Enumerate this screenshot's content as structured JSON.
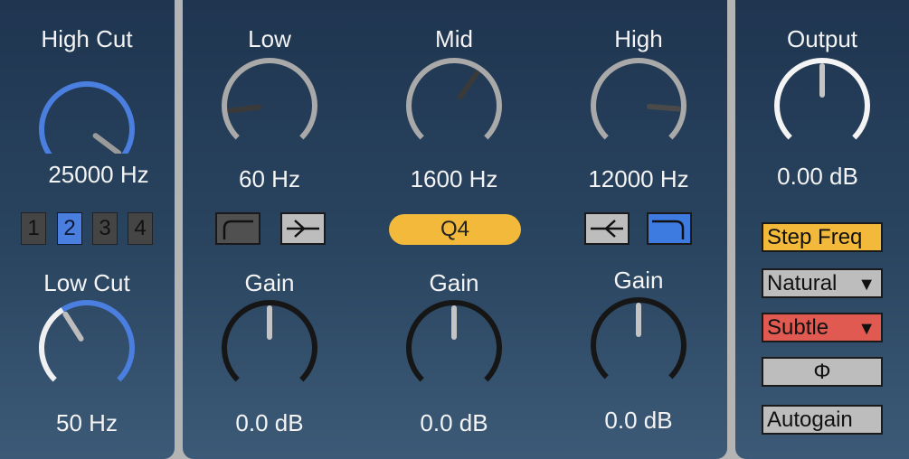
{
  "highcut": {
    "title": "High Cut",
    "value": "25000 Hz",
    "knob_level": 0.97
  },
  "band_selector": [
    {
      "label": "1",
      "active": false
    },
    {
      "label": "2",
      "active": true
    },
    {
      "label": "3",
      "active": false
    },
    {
      "label": "4",
      "active": false
    }
  ],
  "lowcut": {
    "title": "Low Cut",
    "value": "50 Hz",
    "knob_level": 0.38
  },
  "bands": [
    {
      "title": "Low",
      "freq": "60 Hz",
      "gain_label": "Gain",
      "gain": "0.0 dB",
      "freq_level": 0.14,
      "gain_level": 0.5
    },
    {
      "title": "Mid",
      "freq": "1600 Hz",
      "gain_label": "Gain",
      "gain": "0.0 dB",
      "freq_level": 0.63,
      "gain_level": 0.5
    },
    {
      "title": "High",
      "freq": "12000 Hz",
      "gain_label": "Gain",
      "gain": "0.0 dB",
      "freq_level": 0.85,
      "gain_level": 0.5
    }
  ],
  "slope": {
    "label": "Q4"
  },
  "filter_buttons": {
    "low_cut_shelf": {
      "icon": "lowcut-shape-icon",
      "active": false
    },
    "low_shelf": {
      "icon": "low-shelf-icon",
      "active": true
    },
    "high_shelf": {
      "icon": "high-shelf-icon",
      "active": true
    },
    "high_cut_shelf": {
      "icon": "highcut-shape-icon",
      "active": true
    }
  },
  "output": {
    "title": "Output",
    "value": "0.00 dB",
    "knob_level": 0.5
  },
  "options": {
    "step_freq": "Step Freq",
    "mode": "Natural",
    "character": "Subtle",
    "phase": "Φ",
    "autogain": "Autogain"
  },
  "colors": {
    "accent_blue": "#4a7fe0",
    "accent_yellow": "#f2b93b",
    "accent_red": "#e05a52",
    "knob_gray": "#a9a9a9",
    "knob_dark": "#161616"
  }
}
